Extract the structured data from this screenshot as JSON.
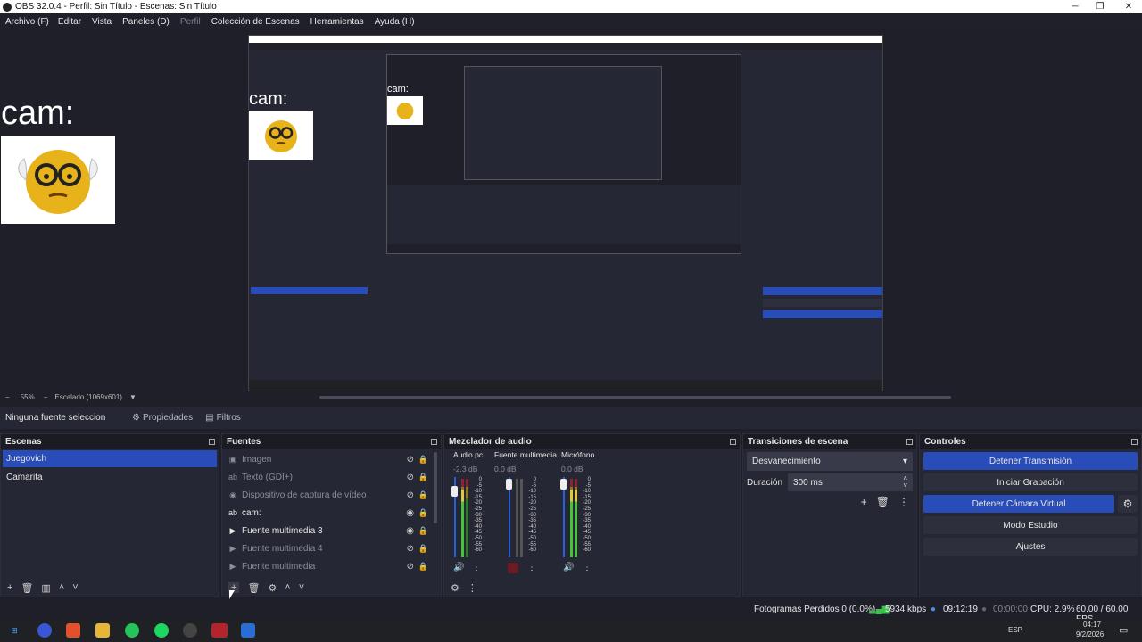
{
  "window": {
    "title": "OBS 32.0.4 - Perfil: Sin Título - Escenas: Sin Título",
    "minimize": "─",
    "maximize": "❐",
    "close": "✕"
  },
  "menu": [
    {
      "label": "Archivo (F)",
      "enabled": true
    },
    {
      "label": "Editar",
      "enabled": true
    },
    {
      "label": "Vista",
      "enabled": true
    },
    {
      "label": "Paneles (D)",
      "enabled": true
    },
    {
      "label": "Perfil",
      "enabled": false
    },
    {
      "label": "Colección de Escenas",
      "enabled": true
    },
    {
      "label": "Herramientas",
      "enabled": true
    },
    {
      "label": "Ayuda (H)",
      "enabled": true
    }
  ],
  "preview": {
    "cam_label": "cam:",
    "zoom": "55%",
    "scaling": "Escalado (1069x601)"
  },
  "context": {
    "no_source": "Ninguna fuente seleccionada",
    "properties": "Propiedades",
    "filters": "Filtros"
  },
  "scenes": {
    "title": "Escenas",
    "items": [
      "Juegovich",
      "Camarita"
    ]
  },
  "sources": {
    "title": "Fuentes",
    "items": [
      {
        "name": "Imagen",
        "icon": "image-icon",
        "visible": false
      },
      {
        "name": "Texto (GDI+)",
        "icon": "text-icon",
        "visible": false
      },
      {
        "name": "Dispositivo de captura de vídeo",
        "icon": "camera-icon",
        "visible": false
      },
      {
        "name": "cam:",
        "icon": "text-icon",
        "visible": true
      },
      {
        "name": "Fuente multimedia 3",
        "icon": "play-icon",
        "visible": true
      },
      {
        "name": "Fuente multimedia 4",
        "icon": "play-icon",
        "visible": false
      },
      {
        "name": "Fuente multimedia",
        "icon": "play-icon",
        "visible": false
      }
    ]
  },
  "mixer": {
    "title": "Mezclador de audio",
    "channels": [
      {
        "name": "Audio pc",
        "db": "-2.3 dB"
      },
      {
        "name": "Fuente multimedia",
        "db": "0.0 dB"
      },
      {
        "name": "Micrófono",
        "db": "0.0 dB"
      }
    ],
    "scale": [
      "0",
      "-5",
      "-10",
      "-15",
      "-20",
      "-25",
      "-30",
      "-35",
      "-40",
      "-45",
      "-50",
      "-55",
      "-60"
    ]
  },
  "transitions": {
    "title": "Transiciones de escena",
    "selected": "Desvanecimiento",
    "duration_label": "Duración",
    "duration_value": "300 ms"
  },
  "controls": {
    "title": "Controles",
    "stop_stream": "Detener Transmisión",
    "start_record": "Iniciar Grabación",
    "stop_virtual_cam": "Detener Cámara Virtual",
    "studio_mode": "Modo Estudio",
    "settings": "Ajustes"
  },
  "status": {
    "dropped": "Fotogramas Perdidos 0 (0.0%)",
    "kbps": "5934 kbps",
    "stream_time": "09:12:19",
    "rec_time": "00:00:00",
    "cpu": "CPU: 2.9%",
    "fps": "60.00 / 60.00 FPS"
  },
  "taskbar": {
    "language": "ESP",
    "time": "04:17",
    "date": "9/2/2026"
  },
  "colors": {
    "accent": "#284cb8",
    "panel": "#262734",
    "background": "#1e1f29"
  }
}
